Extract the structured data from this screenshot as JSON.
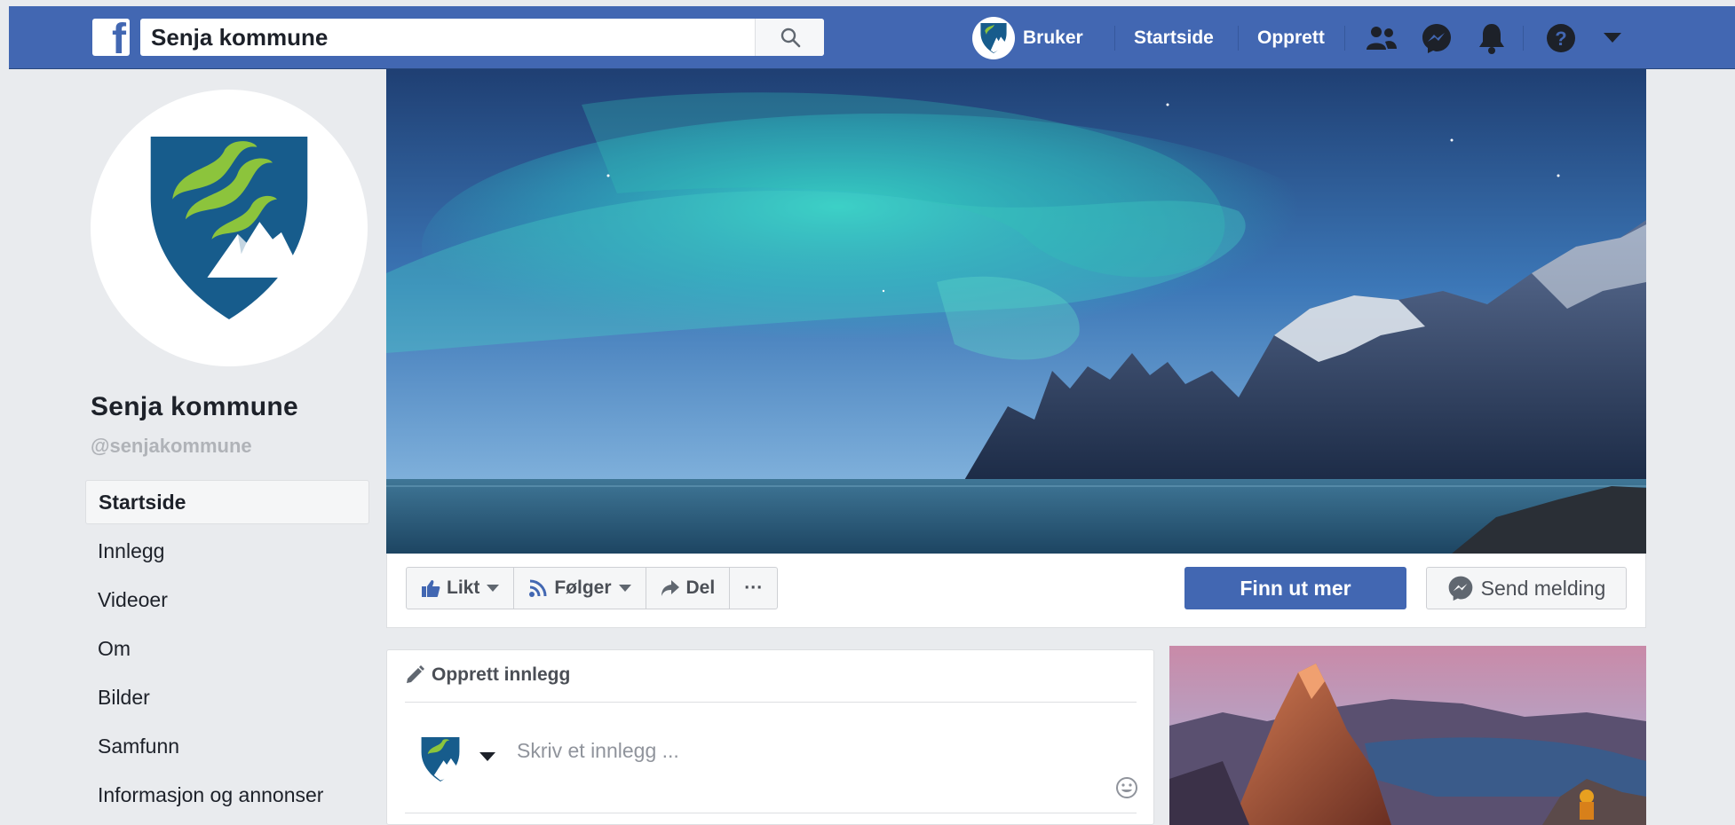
{
  "topbar": {
    "logo_icon": "facebook-f-icon",
    "search_value": "Senja kommune",
    "search_icon": "search-icon",
    "user_label": "Bruker",
    "home_label": "Startside",
    "create_label": "Opprett",
    "icons": [
      "friends-icon",
      "messenger-icon",
      "bell-icon",
      "help-icon",
      "chevron-down-icon"
    ]
  },
  "profile": {
    "name": "Senja kommune",
    "handle": "@senjakommune"
  },
  "sidebar": {
    "items": [
      {
        "label": "Startside",
        "active": true
      },
      {
        "label": "Innlegg"
      },
      {
        "label": "Videoer"
      },
      {
        "label": "Om"
      },
      {
        "label": "Bilder"
      },
      {
        "label": "Samfunn"
      },
      {
        "label": "Informasjon og annonser"
      }
    ]
  },
  "actions": {
    "like_label": "Likt",
    "follow_label": "Følger",
    "share_label": "Del",
    "more_label": "···",
    "primary_label": "Finn ut mer",
    "message_label": "Send melding"
  },
  "create_post": {
    "title": "Opprett innlegg",
    "placeholder": "Skriv et innlegg ..."
  },
  "colors": {
    "brand": "#4267b2",
    "background": "#e9ebee",
    "crest_blue": "#175c8c",
    "crest_green": "#8cc43c"
  }
}
